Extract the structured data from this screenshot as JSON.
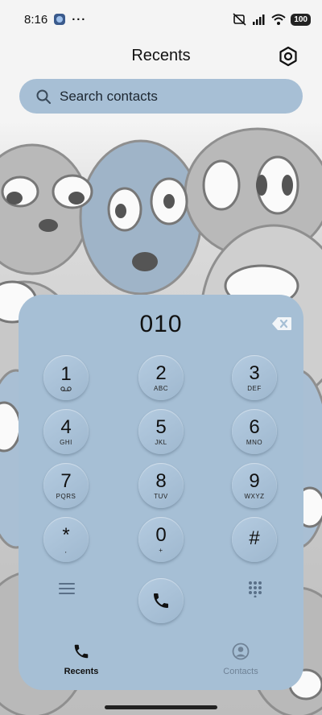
{
  "status_bar": {
    "time": "8:16",
    "dots": "···",
    "battery": "100"
  },
  "header": {
    "title": "Recents"
  },
  "search": {
    "placeholder": "Search contacts"
  },
  "dialer": {
    "number": "010",
    "keys": [
      {
        "digit": "1",
        "letters": "ᴑᴑ"
      },
      {
        "digit": "2",
        "letters": "ABC"
      },
      {
        "digit": "3",
        "letters": "DEF"
      },
      {
        "digit": "4",
        "letters": "GHI"
      },
      {
        "digit": "5",
        "letters": "JKL"
      },
      {
        "digit": "6",
        "letters": "MNO"
      },
      {
        "digit": "7",
        "letters": "PQRS"
      },
      {
        "digit": "8",
        "letters": "TUV"
      },
      {
        "digit": "9",
        "letters": "WXYZ"
      },
      {
        "digit": "*",
        "letters": ","
      },
      {
        "digit": "0",
        "letters": "+"
      },
      {
        "digit": "#",
        "letters": ""
      }
    ]
  },
  "bottom_nav": {
    "recents_label": "Recents",
    "contacts_label": "Contacts"
  },
  "colors": {
    "panel": "#a6bfd5",
    "search_bg": "#a7bfd5",
    "active_nav": "#111111",
    "inactive_nav": "#6f8296"
  },
  "icons": [
    "settings-hex-icon",
    "search-icon",
    "backspace-icon",
    "menu-icon",
    "dialpad-grid-icon",
    "phone-icon",
    "contact-person-icon",
    "voicemail-icon"
  ]
}
